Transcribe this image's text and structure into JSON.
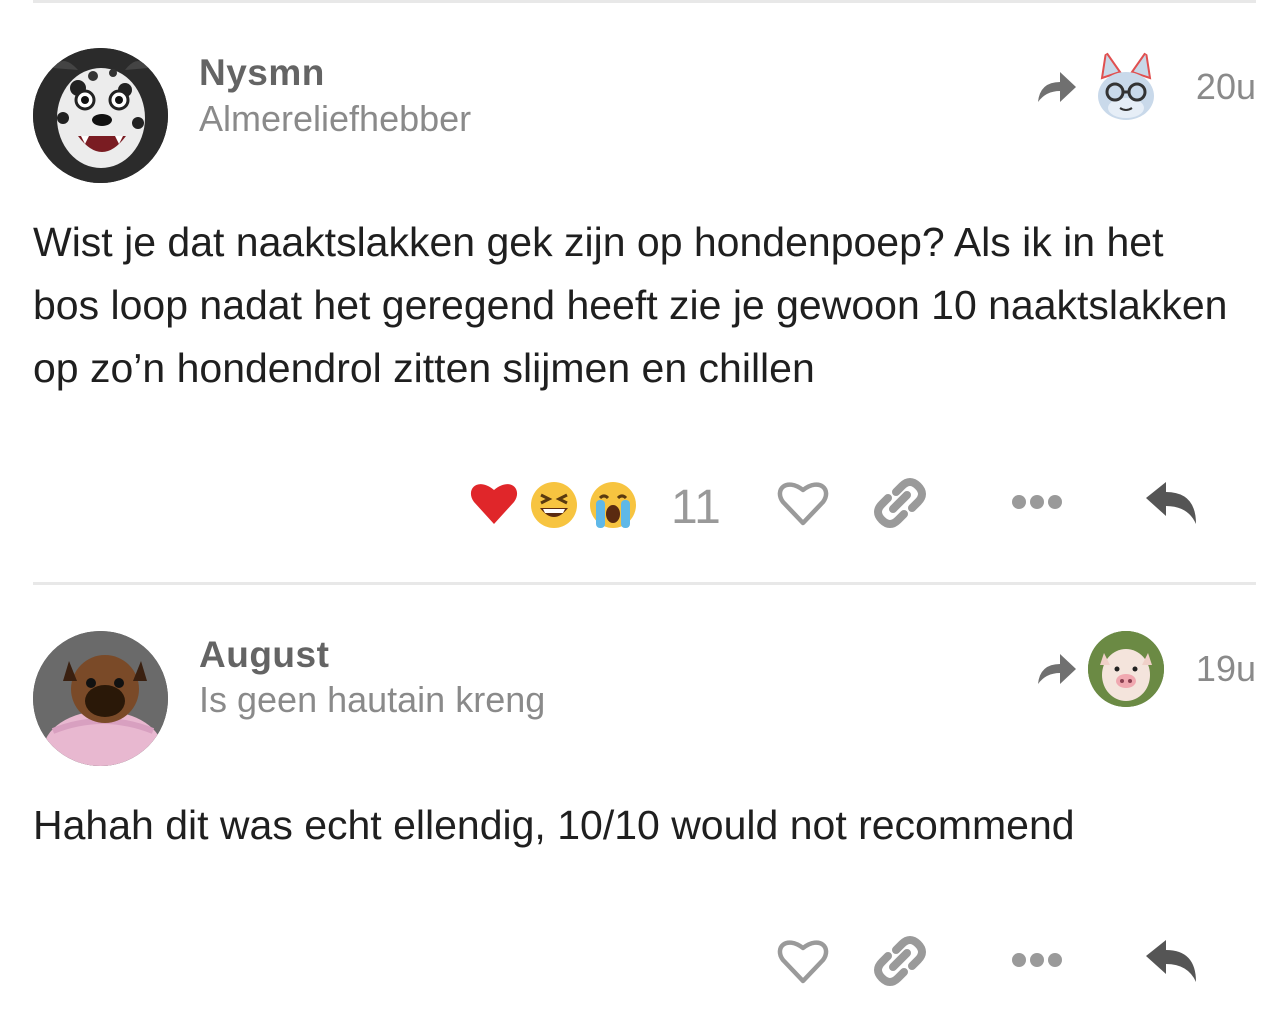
{
  "posts": [
    {
      "username": "Nysmn",
      "user_title": "Almereliefhebber",
      "timestamp": "20u",
      "avatar_icon": "dalmatian-avatar",
      "reply_to_avatar_icon": "cat-glasses-avatar",
      "body": "Wist je dat naaktslakken gek zijn op hondenpoep? Als ik in het bos loop nadat het geregend heeft zie je gewoon 10 naaktslakken op zo’n hondendrol zitten slijmen en chillen",
      "reactions": [
        "heart",
        "laughing",
        "crying"
      ],
      "reaction_count": "11"
    },
    {
      "username": "August",
      "user_title": "Is geen hautain kreng",
      "timestamp": "19u",
      "avatar_icon": "pug-sweater-avatar",
      "reply_to_avatar_icon": "piglet-avatar",
      "body": "Hahah dit was echt ellendig, 10/10 would not recommend"
    }
  ],
  "colors": {
    "icon_gray": "#9a9a9a",
    "reply_icon": "#555555",
    "heart_red": "#e0262a"
  }
}
